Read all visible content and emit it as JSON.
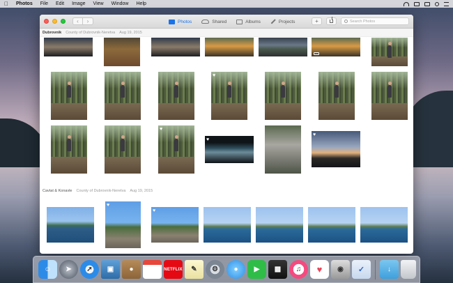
{
  "menubar": {
    "apple": "",
    "app_name": "Photos",
    "items": [
      "File",
      "Edit",
      "Image",
      "View",
      "Window",
      "Help"
    ]
  },
  "toolbar": {
    "back_glyph": "‹",
    "forward_glyph": "›",
    "tabs": [
      {
        "label": "Photos",
        "icon": "photos-icon",
        "active": true
      },
      {
        "label": "Shared",
        "icon": "cloud-icon",
        "active": false
      },
      {
        "label": "Albums",
        "icon": "albums-icon",
        "active": false
      },
      {
        "label": "Projects",
        "icon": "projects-icon",
        "active": false
      }
    ],
    "add_glyph": "+",
    "search_placeholder": "Search Photos"
  },
  "moments": [
    {
      "place": "Dubrovnik",
      "region": "County of Dubrovnik-Neretva",
      "date": "Aug 19, 2015"
    },
    {
      "place": "Cavtat & Konavle",
      "region": "County of Dubrovnik-Neretva",
      "date": "Aug 19, 2015"
    }
  ],
  "colors": {
    "accent": "#1a73e8",
    "window_bg": "#ffffff",
    "toolbar_bg": "#e2e2e2"
  },
  "dock": {
    "calendar_day": "",
    "netflix_label": "NETFLIX",
    "items": [
      "finder-icon",
      "launchpad-icon",
      "safari-icon",
      "preview-icon",
      "contacts-icon",
      "calendar-icon",
      "netflix-icon",
      "textedit-icon",
      "system-preferences-icon",
      "messages-icon",
      "facetime-icon",
      "photo-booth-icon",
      "itunes-icon",
      "photos-app-icon",
      "camera-icon",
      "mail-icon",
      "downloads-folder-icon",
      "trash-icon"
    ]
  }
}
